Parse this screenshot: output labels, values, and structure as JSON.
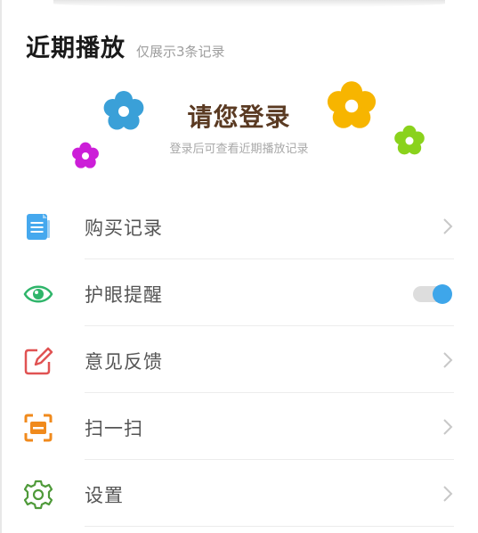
{
  "recent": {
    "title": "近期播放",
    "subtitle": "仅展示3条记录"
  },
  "login": {
    "title": "请您登录",
    "hint": "登录后可查看近期播放记录"
  },
  "menu": {
    "items": [
      {
        "label": "购买记录",
        "icon": "document-icon",
        "control": "chevron"
      },
      {
        "label": "护眼提醒",
        "icon": "eye-icon",
        "control": "toggle",
        "toggle_on": true
      },
      {
        "label": "意见反馈",
        "icon": "edit-icon",
        "control": "chevron"
      },
      {
        "label": "扫一扫",
        "icon": "scan-icon",
        "control": "chevron"
      },
      {
        "label": "设置",
        "icon": "gear-icon",
        "control": "chevron"
      }
    ]
  },
  "colors": {
    "accent_blue": "#3ea6ea",
    "login_title": "#5a3a22",
    "flower_blue": "#3aa0d8",
    "flower_yellow": "#f7b500",
    "flower_purple": "#cc1ed8",
    "flower_green": "#8ad21c"
  }
}
